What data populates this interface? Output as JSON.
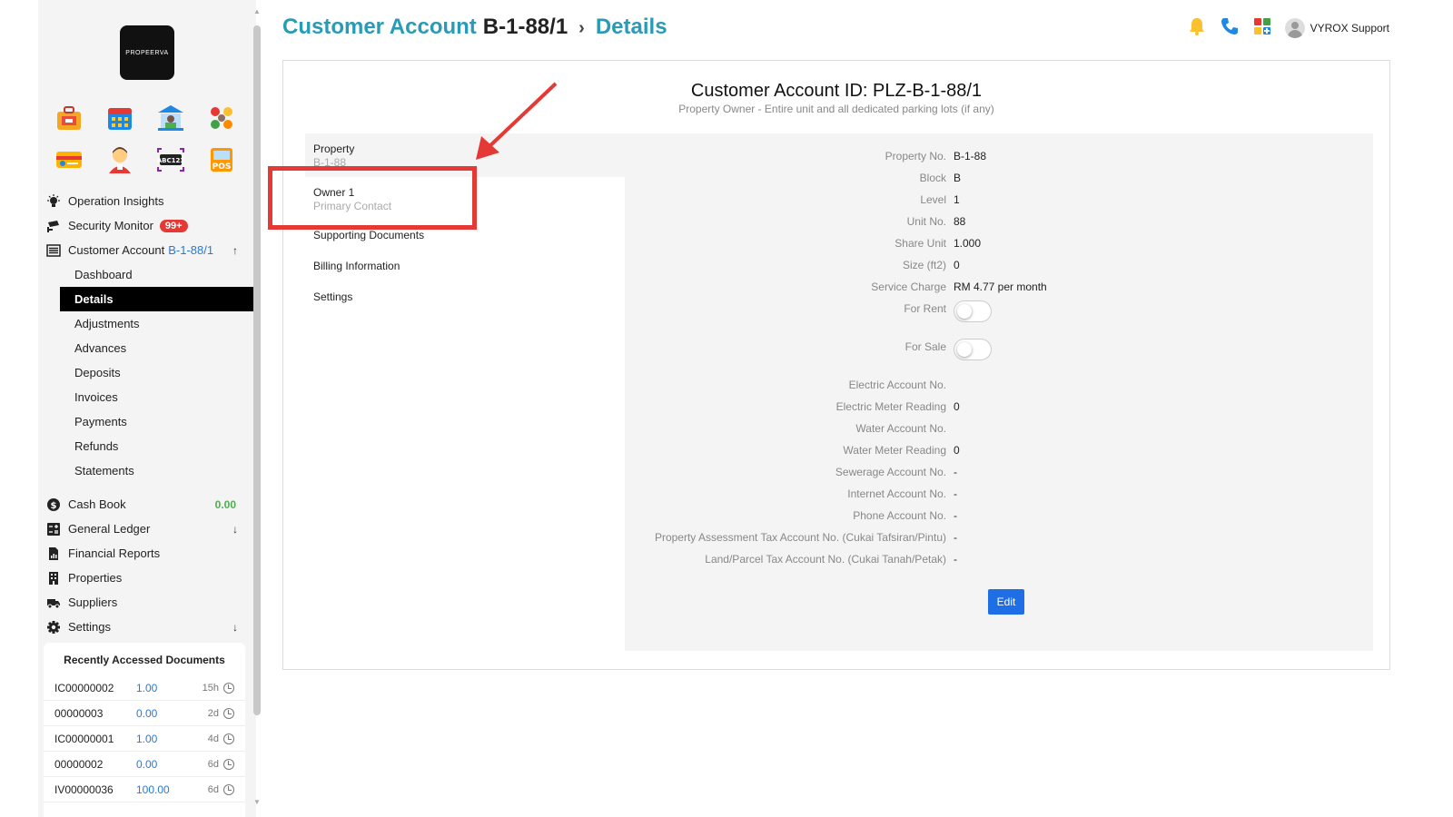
{
  "app": {
    "logo_text": "PROPEERVA",
    "user_name": "VYROX Support",
    "brand_color": "#2a9bb7"
  },
  "header": {
    "title_prefix": "Customer Account",
    "account_id": "B-1-88/1",
    "separator": "›",
    "section": "Details"
  },
  "app_icons": [
    "briefcase-icon",
    "calendar-icon",
    "bank-icon",
    "people-icon",
    "ticket-icon",
    "user-face-icon",
    "abc123-icon",
    "pos-icon"
  ],
  "app_icon_labels": {
    "abc": "ABC123",
    "pos": "POS"
  },
  "sidebar": {
    "operation_insights": "Operation Insights",
    "security_monitor": "Security Monitor",
    "security_badge": "99+",
    "customer_account": "Customer Account",
    "customer_account_id": "B-1-88/1",
    "customer_account_arrow": "↑",
    "sub_items": [
      "Dashboard",
      "Details",
      "Adjustments",
      "Advances",
      "Deposits",
      "Invoices",
      "Payments",
      "Refunds",
      "Statements"
    ],
    "cash_book": "Cash Book",
    "cash_book_value": "0.00",
    "general_ledger": "General Ledger",
    "general_ledger_arrow": "↓",
    "financial_reports": "Financial Reports",
    "properties": "Properties",
    "suppliers": "Suppliers",
    "settings": "Settings",
    "settings_arrow": "↓"
  },
  "recent": {
    "title": "Recently Accessed Documents",
    "rows": [
      {
        "code": "IC00000002",
        "amount": "1.00",
        "age": "15h"
      },
      {
        "code": "00000003",
        "amount": "0.00",
        "age": "2d"
      },
      {
        "code": "IC00000001",
        "amount": "1.00",
        "age": "4d"
      },
      {
        "code": "00000002",
        "amount": "0.00",
        "age": "6d"
      },
      {
        "code": "IV00000036",
        "amount": "100.00",
        "age": "6d"
      }
    ]
  },
  "card": {
    "title": "Customer Account ID: PLZ-B-1-88/1",
    "subtitle": "Property Owner - Entire unit and all dedicated parking lots (if any)"
  },
  "tabs": {
    "property_label": "Property",
    "property_sub": "B-1-88",
    "owner_label": "Owner 1",
    "owner_sub": "Primary Contact",
    "supporting_documents": "Supporting Documents",
    "billing_information": "Billing Information",
    "settings": "Settings"
  },
  "fields": {
    "property_no": {
      "label": "Property No.",
      "value": "B-1-88"
    },
    "block": {
      "label": "Block",
      "value": "B"
    },
    "level": {
      "label": "Level",
      "value": "1"
    },
    "unit_no": {
      "label": "Unit No.",
      "value": "88"
    },
    "share_unit": {
      "label": "Share Unit",
      "value": "1.000"
    },
    "size": {
      "label": "Size (ft2)",
      "value": "0"
    },
    "service_charge": {
      "label": "Service Charge",
      "value": "RM 4.77 per month"
    },
    "for_rent": {
      "label": "For Rent"
    },
    "for_sale": {
      "label": "For Sale"
    },
    "electric_account": {
      "label": "Electric Account No.",
      "value": ""
    },
    "electric_meter": {
      "label": "Electric Meter Reading",
      "value": "0"
    },
    "water_account": {
      "label": "Water Account No.",
      "value": ""
    },
    "water_meter": {
      "label": "Water Meter Reading",
      "value": "0"
    },
    "sewerage_account": {
      "label": "Sewerage Account No.",
      "value": "-"
    },
    "internet_account": {
      "label": "Internet Account No.",
      "value": "-"
    },
    "phone_account": {
      "label": "Phone Account No.",
      "value": "-"
    },
    "assessment_tax": {
      "label": "Property Assessment Tax Account No. (Cukai Tafsiran/Pintu)",
      "value": "-"
    },
    "land_tax": {
      "label": "Land/Parcel Tax Account No. (Cukai Tanah/Petak)",
      "value": "-"
    }
  },
  "edit_button": "Edit",
  "annotation_color": "#e53935"
}
